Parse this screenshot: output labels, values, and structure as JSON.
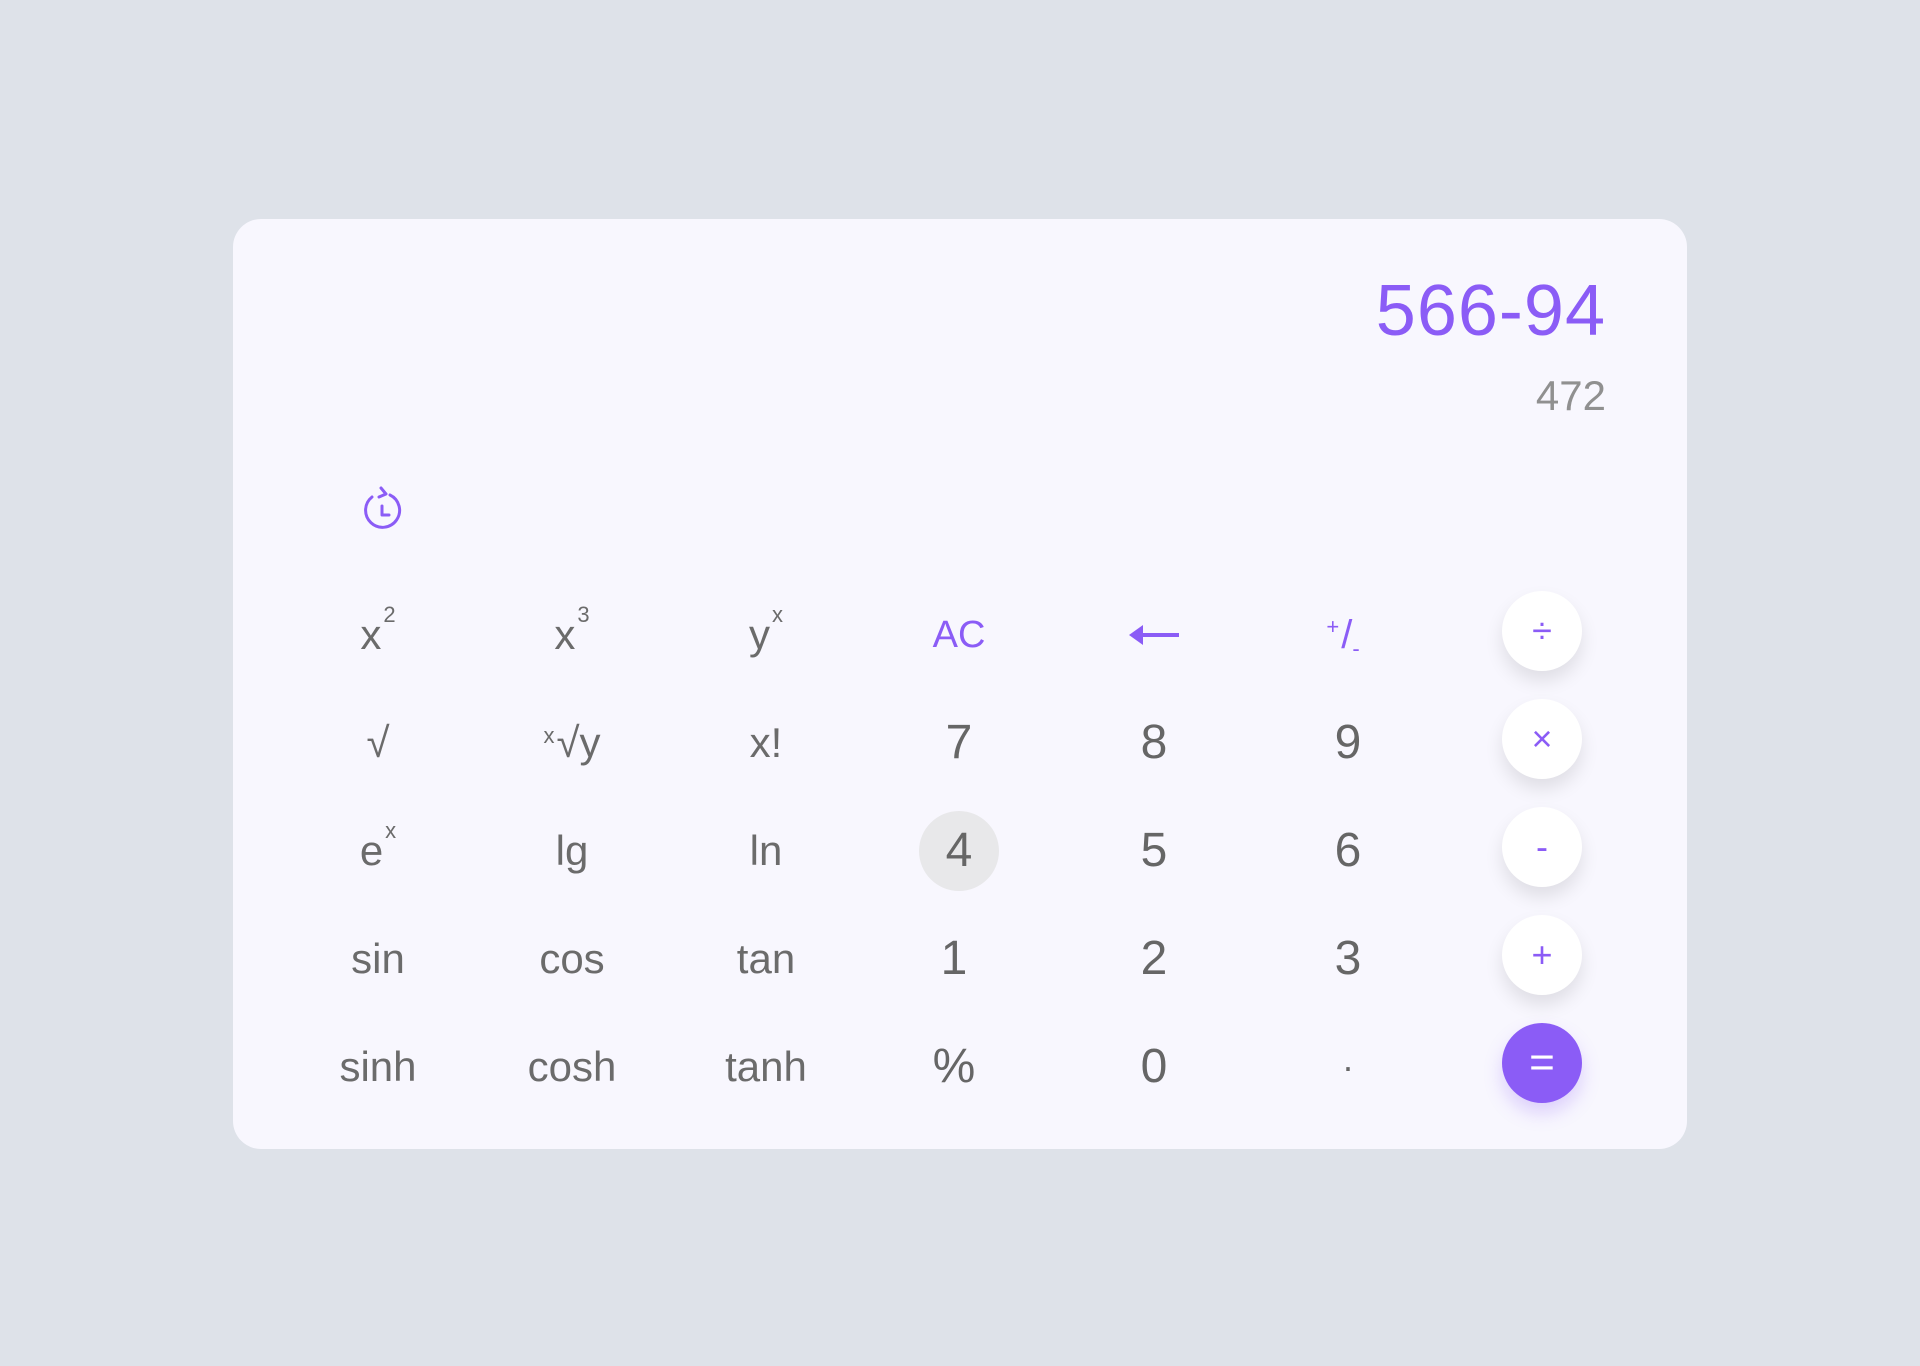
{
  "display": {
    "expression": "566-94",
    "result": "472"
  },
  "history_icon": "history-clock-icon",
  "colors": {
    "accent": "#8b5cf6",
    "text": "#6b6b6b",
    "background": "#dee2e9",
    "card": "#f8f7fe"
  },
  "keys": {
    "x2": {
      "base": "x",
      "sup": "2"
    },
    "x3": {
      "base": "x",
      "sup": "3"
    },
    "yx": {
      "base": "y",
      "sup": "x"
    },
    "ac": "AC",
    "backspace_icon": "left-arrow-icon",
    "sign": {
      "plus": "+",
      "slash": "/",
      "minus": "-"
    },
    "divide": "÷",
    "sqrt": "√",
    "xroot": {
      "pre": "x",
      "base": "√y"
    },
    "fact": "x!",
    "seven": "7",
    "eight": "8",
    "nine": "9",
    "multiply": "×",
    "ex": {
      "base": "e",
      "sup": "x"
    },
    "lg": "lg",
    "ln": "ln",
    "four": "4",
    "five": "5",
    "six": "6",
    "subtract": "-",
    "sin": "sin",
    "cos": "cos",
    "tan": "tan",
    "one": "1",
    "two": "2",
    "three": "3",
    "add": "+",
    "sinh": "sinh",
    "cosh": "cosh",
    "tanh": "tanh",
    "percent": "%",
    "zero": "0",
    "dot": "·",
    "equals": "="
  }
}
